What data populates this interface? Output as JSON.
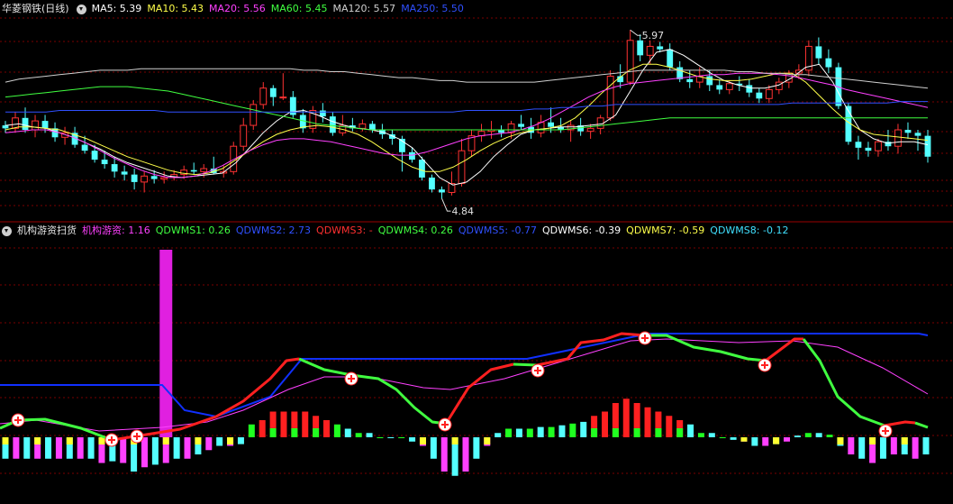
{
  "stock": {
    "title": "华菱钢铁(日线)",
    "ma": [
      {
        "label": "MA5: 5.39",
        "color": "#ffffff"
      },
      {
        "label": "MA10: 5.43",
        "color": "#ffff4a"
      },
      {
        "label": "MA20: 5.56",
        "color": "#ff40ff"
      },
      {
        "label": "MA60: 5.45",
        "color": "#40ff40"
      },
      {
        "label": "MA120: 5.57",
        "color": "#cfcfcf"
      },
      {
        "label": "MA250: 5.50",
        "color": "#3050ff"
      }
    ],
    "high_label": "5.97",
    "low_label": "4.84"
  },
  "indicator": {
    "title": "机构游资扫货",
    "items": [
      {
        "label": "机构游资: 1.16",
        "color": "#ff40ff"
      },
      {
        "label": "QDWMS1: 0.26",
        "color": "#40ff40"
      },
      {
        "label": "QDWMS2: 2.73",
        "color": "#3050ff"
      },
      {
        "label": "QDWMS3: -",
        "color": "#ff3030"
      },
      {
        "label": "QDWMS4: 0.26",
        "color": "#40ff40"
      },
      {
        "label": "QDWMS5: -0.77",
        "color": "#3050ff"
      },
      {
        "label": "QDWMS6: -0.39",
        "color": "#ffffff"
      },
      {
        "label": "QDWMS7: -0.59",
        "color": "#ffff4a"
      },
      {
        "label": "QDWMS8: -0.12",
        "color": "#40e0ff"
      }
    ]
  },
  "chart_data": [
    {
      "type": "candlestick",
      "title": "华菱钢铁(日线)",
      "annotations": {
        "high": 5.97,
        "low": 4.84
      },
      "ohlc": [
        [
          5.33,
          5.36,
          5.28,
          5.31
        ],
        [
          5.31,
          5.42,
          5.28,
          5.38
        ],
        [
          5.38,
          5.45,
          5.28,
          5.3
        ],
        [
          5.3,
          5.4,
          5.25,
          5.36
        ],
        [
          5.36,
          5.4,
          5.28,
          5.31
        ],
        [
          5.31,
          5.35,
          5.22,
          5.25
        ],
        [
          5.25,
          5.32,
          5.2,
          5.28
        ],
        [
          5.28,
          5.32,
          5.18,
          5.2
        ],
        [
          5.2,
          5.26,
          5.14,
          5.16
        ],
        [
          5.16,
          5.2,
          5.08,
          5.1
        ],
        [
          5.1,
          5.16,
          5.04,
          5.07
        ],
        [
          5.07,
          5.12,
          4.98,
          5.02
        ],
        [
          5.02,
          5.06,
          4.96,
          5.0
        ],
        [
          5.0,
          5.04,
          4.9,
          4.95
        ],
        [
          4.95,
          5.02,
          4.88,
          4.99
        ],
        [
          4.99,
          5.03,
          4.94,
          4.97
        ],
        [
          4.97,
          5.02,
          4.94,
          4.98
        ],
        [
          4.98,
          5.03,
          4.96,
          5.0
        ],
        [
          5.0,
          5.06,
          4.97,
          5.03
        ],
        [
          5.03,
          5.08,
          5.0,
          5.02
        ],
        [
          5.02,
          5.07,
          4.98,
          5.04
        ],
        [
          5.04,
          5.12,
          5.0,
          5.01
        ],
        [
          5.01,
          5.06,
          4.98,
          5.02
        ],
        [
          5.02,
          5.22,
          5.0,
          5.19
        ],
        [
          5.19,
          5.38,
          5.16,
          5.33
        ],
        [
          5.33,
          5.5,
          5.3,
          5.47
        ],
        [
          5.47,
          5.62,
          5.44,
          5.58
        ],
        [
          5.58,
          5.6,
          5.46,
          5.52
        ],
        [
          5.52,
          5.68,
          5.5,
          5.52
        ],
        [
          5.52,
          5.56,
          5.38,
          5.4
        ],
        [
          5.4,
          5.44,
          5.28,
          5.31
        ],
        [
          5.31,
          5.46,
          5.28,
          5.43
        ],
        [
          5.43,
          5.48,
          5.35,
          5.39
        ],
        [
          5.39,
          5.42,
          5.26,
          5.28
        ],
        [
          5.28,
          5.4,
          5.26,
          5.33
        ],
        [
          5.33,
          5.38,
          5.29,
          5.31
        ],
        [
          5.31,
          5.37,
          5.29,
          5.34
        ],
        [
          5.34,
          5.36,
          5.28,
          5.3
        ],
        [
          5.3,
          5.34,
          5.24,
          5.27
        ],
        [
          5.27,
          5.3,
          5.2,
          5.24
        ],
        [
          5.24,
          5.26,
          5.02,
          5.15
        ],
        [
          5.15,
          5.18,
          5.08,
          5.1
        ],
        [
          5.1,
          5.12,
          4.96,
          4.98
        ],
        [
          4.98,
          5.0,
          4.88,
          4.9
        ],
        [
          4.9,
          4.92,
          4.84,
          4.88
        ],
        [
          4.88,
          5.02,
          4.86,
          4.94
        ],
        [
          4.94,
          5.24,
          4.92,
          5.16
        ],
        [
          5.16,
          5.3,
          5.12,
          5.26
        ],
        [
          5.26,
          5.34,
          5.22,
          5.29
        ],
        [
          5.29,
          5.36,
          5.24,
          5.3
        ],
        [
          5.3,
          5.33,
          5.25,
          5.28
        ],
        [
          5.28,
          5.36,
          5.24,
          5.34
        ],
        [
          5.34,
          5.4,
          5.3,
          5.32
        ],
        [
          5.32,
          5.38,
          5.24,
          5.28
        ],
        [
          5.28,
          5.4,
          5.25,
          5.35
        ],
        [
          5.35,
          5.45,
          5.28,
          5.32
        ],
        [
          5.32,
          5.38,
          5.28,
          5.3
        ],
        [
          5.3,
          5.36,
          5.22,
          5.33
        ],
        [
          5.33,
          5.38,
          5.26,
          5.29
        ],
        [
          5.29,
          5.34,
          5.24,
          5.31
        ],
        [
          5.31,
          5.4,
          5.27,
          5.38
        ],
        [
          5.38,
          5.7,
          5.36,
          5.66
        ],
        [
          5.66,
          5.74,
          5.58,
          5.62
        ],
        [
          5.62,
          5.97,
          5.6,
          5.9
        ],
        [
          5.9,
          5.94,
          5.76,
          5.8
        ],
        [
          5.8,
          5.9,
          5.74,
          5.86
        ],
        [
          5.86,
          5.89,
          5.82,
          5.84
        ],
        [
          5.84,
          5.88,
          5.7,
          5.72
        ],
        [
          5.72,
          5.76,
          5.62,
          5.64
        ],
        [
          5.64,
          5.7,
          5.58,
          5.62
        ],
        [
          5.62,
          5.72,
          5.58,
          5.66
        ],
        [
          5.66,
          5.7,
          5.56,
          5.6
        ],
        [
          5.6,
          5.64,
          5.54,
          5.57
        ],
        [
          5.57,
          5.63,
          5.54,
          5.61
        ],
        [
          5.61,
          5.66,
          5.56,
          5.6
        ],
        [
          5.6,
          5.64,
          5.52,
          5.55
        ],
        [
          5.55,
          5.58,
          5.48,
          5.51
        ],
        [
          5.51,
          5.6,
          5.48,
          5.57
        ],
        [
          5.57,
          5.65,
          5.54,
          5.62
        ],
        [
          5.62,
          5.7,
          5.58,
          5.68
        ],
        [
          5.68,
          5.74,
          5.64,
          5.7
        ],
        [
          5.7,
          5.9,
          5.66,
          5.86
        ],
        [
          5.86,
          5.92,
          5.74,
          5.78
        ],
        [
          5.78,
          5.84,
          5.68,
          5.72
        ],
        [
          5.72,
          5.75,
          5.44,
          5.46
        ],
        [
          5.46,
          5.48,
          5.2,
          5.22
        ],
        [
          5.22,
          5.26,
          5.1,
          5.18
        ],
        [
          5.18,
          5.22,
          5.12,
          5.16
        ],
        [
          5.16,
          5.24,
          5.12,
          5.22
        ],
        [
          5.22,
          5.3,
          5.16,
          5.19
        ],
        [
          5.19,
          5.34,
          5.14,
          5.3
        ],
        [
          5.3,
          5.35,
          5.24,
          5.28
        ],
        [
          5.28,
          5.3,
          5.16,
          5.26
        ],
        [
          5.26,
          5.3,
          5.08,
          5.12
        ]
      ],
      "series": [
        {
          "name": "MA5",
          "values": [
            5.33,
            5.34,
            5.32,
            5.31,
            5.28,
            5.25,
            5.21,
            5.17,
            5.12,
            5.08,
            5.05,
            5.02,
            4.99,
            4.98,
            4.99,
            5.0,
            5.01,
            5.08,
            5.18,
            5.28,
            5.36,
            5.42,
            5.43,
            5.4,
            5.36,
            5.33,
            5.31,
            5.3,
            5.28,
            5.24,
            5.18,
            5.08,
            4.98,
            4.93,
            4.95,
            5.02,
            5.12,
            5.2,
            5.27,
            5.3,
            5.31,
            5.32,
            5.32,
            5.33,
            5.34,
            5.4,
            5.55,
            5.7,
            5.82,
            5.84,
            5.8,
            5.74,
            5.68,
            5.63,
            5.6,
            5.58,
            5.58,
            5.6,
            5.65,
            5.72,
            5.74,
            5.62,
            5.45,
            5.3,
            5.24,
            5.21,
            5.22,
            5.22,
            5.2
          ]
        },
        {
          "name": "MA10",
          "values": [
            5.3,
            5.32,
            5.32,
            5.31,
            5.3,
            5.27,
            5.24,
            5.2,
            5.16,
            5.12,
            5.09,
            5.06,
            5.03,
            5.01,
            5.0,
            5.01,
            5.04,
            5.1,
            5.16,
            5.22,
            5.27,
            5.3,
            5.32,
            5.33,
            5.32,
            5.3,
            5.27,
            5.22,
            5.16,
            5.1,
            5.05,
            5.02,
            5.02,
            5.05,
            5.1,
            5.16,
            5.21,
            5.25,
            5.28,
            5.3,
            5.31,
            5.33,
            5.38,
            5.46,
            5.55,
            5.63,
            5.7,
            5.74,
            5.74,
            5.72,
            5.69,
            5.66,
            5.64,
            5.63,
            5.63,
            5.64,
            5.66,
            5.68,
            5.68,
            5.62,
            5.53,
            5.44,
            5.36,
            5.3,
            5.27,
            5.26,
            5.25,
            5.24,
            5.23
          ]
        },
        {
          "name": "MA20",
          "values": [
            5.28,
            5.29,
            5.3,
            5.3,
            5.28,
            5.25,
            5.21,
            5.16,
            5.11,
            5.07,
            5.03,
            5.0,
            4.98,
            4.98,
            4.99,
            5.02,
            5.06,
            5.11,
            5.16,
            5.2,
            5.23,
            5.24,
            5.24,
            5.23,
            5.22,
            5.2,
            5.18,
            5.16,
            5.14,
            5.13,
            5.13,
            5.15,
            5.18,
            5.21,
            5.24,
            5.26,
            5.27,
            5.28,
            5.3,
            5.33,
            5.37,
            5.42,
            5.47,
            5.52,
            5.56,
            5.59,
            5.61,
            5.62,
            5.63,
            5.64,
            5.65,
            5.66,
            5.67,
            5.67,
            5.68,
            5.68,
            5.68,
            5.67,
            5.66,
            5.64,
            5.62,
            5.6,
            5.57,
            5.55,
            5.53,
            5.51,
            5.49,
            5.47,
            5.45
          ]
        },
        {
          "name": "MA60",
          "values": [
            5.52,
            5.53,
            5.54,
            5.55,
            5.56,
            5.57,
            5.58,
            5.59,
            5.59,
            5.59,
            5.58,
            5.57,
            5.56,
            5.54,
            5.52,
            5.5,
            5.48,
            5.46,
            5.44,
            5.42,
            5.4,
            5.38,
            5.36,
            5.34,
            5.33,
            5.32,
            5.31,
            5.3,
            5.3,
            5.3,
            5.3,
            5.3,
            5.3,
            5.3,
            5.3,
            5.3,
            5.3,
            5.3,
            5.3,
            5.3,
            5.3,
            5.3,
            5.31,
            5.32,
            5.33,
            5.34,
            5.35,
            5.36,
            5.37,
            5.38,
            5.38,
            5.38,
            5.38,
            5.38,
            5.38,
            5.38,
            5.38,
            5.38,
            5.38,
            5.38,
            5.38,
            5.38,
            5.38,
            5.38,
            5.38,
            5.38,
            5.38,
            5.38,
            5.38
          ]
        },
        {
          "name": "MA120",
          "values": [
            5.62,
            5.64,
            5.65,
            5.66,
            5.67,
            5.68,
            5.69,
            5.7,
            5.7,
            5.7,
            5.71,
            5.71,
            5.71,
            5.71,
            5.71,
            5.71,
            5.71,
            5.71,
            5.71,
            5.71,
            5.71,
            5.71,
            5.7,
            5.7,
            5.69,
            5.69,
            5.68,
            5.67,
            5.66,
            5.65,
            5.65,
            5.64,
            5.63,
            5.63,
            5.62,
            5.62,
            5.62,
            5.62,
            5.62,
            5.62,
            5.63,
            5.64,
            5.65,
            5.66,
            5.67,
            5.68,
            5.69,
            5.7,
            5.7,
            5.7,
            5.7,
            5.7,
            5.7,
            5.7,
            5.69,
            5.69,
            5.68,
            5.68,
            5.67,
            5.67,
            5.66,
            5.65,
            5.64,
            5.63,
            5.62,
            5.61,
            5.6,
            5.59,
            5.58
          ]
        },
        {
          "name": "MA250",
          "values": [
            5.42,
            5.42,
            5.42,
            5.42,
            5.43,
            5.43,
            5.43,
            5.43,
            5.43,
            5.43,
            5.43,
            5.43,
            5.42,
            5.42,
            5.42,
            5.42,
            5.42,
            5.42,
            5.42,
            5.42,
            5.42,
            5.42,
            5.42,
            5.42,
            5.42,
            5.42,
            5.42,
            5.42,
            5.42,
            5.42,
            5.42,
            5.42,
            5.42,
            5.42,
            5.43,
            5.43,
            5.43,
            5.43,
            5.43,
            5.44,
            5.44,
            5.45,
            5.45,
            5.46,
            5.46,
            5.47,
            5.47,
            5.47,
            5.47,
            5.47,
            5.47,
            5.47,
            5.47,
            5.47,
            5.47,
            5.47,
            5.47,
            5.47,
            5.48,
            5.48,
            5.48,
            5.48,
            5.48,
            5.48,
            5.48,
            5.48,
            5.49,
            5.49,
            5.49
          ]
        }
      ]
    },
    {
      "type": "bar",
      "title": "机构游资扫货",
      "values": [
        -0.25,
        -0.25,
        -0.25,
        -0.25,
        -0.25,
        -0.25,
        -0.25,
        -0.25,
        -0.25,
        -0.3,
        -0.28,
        -0.3,
        -0.4,
        -0.35,
        -0.32,
        -0.3,
        -0.25,
        -0.25,
        -0.2,
        -0.15,
        -0.1,
        -0.1,
        -0.08,
        0.15,
        0.2,
        0.3,
        0.3,
        0.3,
        0.3,
        0.25,
        0.2,
        0.15,
        0.1,
        0.05,
        0.05,
        0.0,
        0.0,
        0.0,
        -0.05,
        -0.1,
        -0.25,
        -0.4,
        -0.45,
        -0.4,
        -0.25,
        -0.1,
        0.05,
        0.1,
        0.1,
        0.1,
        0.12,
        0.12,
        0.14,
        0.16,
        0.18,
        0.25,
        0.3,
        0.4,
        0.45,
        0.4,
        0.35,
        0.3,
        0.25,
        0.2,
        0.15,
        0.05,
        0.05,
        0.0,
        -0.03,
        -0.05,
        -0.1,
        -0.1,
        -0.08,
        -0.05,
        0.02,
        0.05,
        0.05,
        0.03,
        -0.1,
        -0.2,
        -0.25,
        -0.3,
        -0.25,
        -0.2,
        -0.2,
        -0.25,
        -0.2
      ],
      "spike": {
        "index": 15,
        "value": 1.16
      },
      "signals": [
        1,
        9,
        11,
        38,
        57,
        69,
        82,
        94
      ]
    }
  ]
}
